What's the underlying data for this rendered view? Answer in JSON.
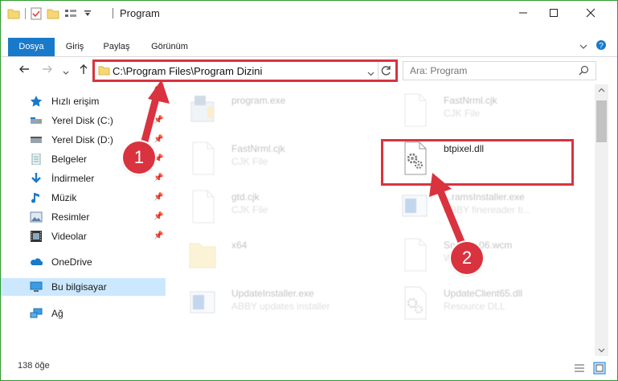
{
  "window": {
    "title": "Program"
  },
  "ribbon": {
    "tabs": [
      {
        "label": "Dosya",
        "active": true
      },
      {
        "label": "Giriş",
        "active": false
      },
      {
        "label": "Paylaş",
        "active": false
      },
      {
        "label": "Görünüm",
        "active": false
      }
    ]
  },
  "address": {
    "path": "C:\\Program Files\\Program Dizini"
  },
  "search": {
    "placeholder": "Ara: Program"
  },
  "sidebar": {
    "items": [
      {
        "label": "Hızlı erişim",
        "icon": "star-icon"
      },
      {
        "label": "Yerel Disk (C:)",
        "icon": "drive-icon",
        "pinned": true
      },
      {
        "label": "Yerel Disk (D:)",
        "icon": "drive-icon",
        "pinned": true
      },
      {
        "label": "Belgeler",
        "icon": "documents-icon",
        "pinned": true
      },
      {
        "label": "İndirmeler",
        "icon": "download-icon",
        "pinned": true
      },
      {
        "label": "Müzik",
        "icon": "music-icon",
        "pinned": true
      },
      {
        "label": "Resimler",
        "icon": "pictures-icon",
        "pinned": true
      },
      {
        "label": "Videolar",
        "icon": "video-icon",
        "pinned": true
      },
      {
        "label": "OneDrive",
        "icon": "onedrive-icon"
      },
      {
        "label": "Bu bilgisayar",
        "icon": "computer-icon",
        "selected": true
      },
      {
        "label": "Ağ",
        "icon": "network-icon"
      }
    ]
  },
  "files": [
    {
      "name": "program.exe",
      "type": "",
      "icon": "exe-icon"
    },
    {
      "name": "FastNrml.cjk",
      "type": "CJK File",
      "icon": "blank-file-icon"
    },
    {
      "name": "FastNrml.cjk",
      "type": "CJK File",
      "icon": "blank-file-icon"
    },
    {
      "name": "btpixel.dll",
      "type": "",
      "icon": "dll-gears-icon"
    },
    {
      "name": "gtd.cjk",
      "type": "CJK File",
      "icon": "blank-file-icon"
    },
    {
      "name": "...ramsInstaller.exe",
      "type": "ABBY finereader ti...",
      "icon": "installer-icon"
    },
    {
      "name": "x64",
      "type": "",
      "icon": "folder-icon"
    },
    {
      "name": "SndTo...06.wcm",
      "type": "WCM...",
      "icon": "blank-file-icon"
    },
    {
      "name": "UpdateInstaller.exe",
      "type": "ABBY updates installer",
      "icon": "installer-icon"
    },
    {
      "name": "UpdateClient65.dll",
      "type": "Resource DLL",
      "icon": "dll-gears-icon"
    }
  ],
  "status": {
    "item_count": "138 öğe"
  },
  "annotations": {
    "badge1": "1",
    "badge2": "2"
  },
  "colors": {
    "accent": "#1979ca",
    "annotation": "#d9333f",
    "selection": "#cce8ff"
  }
}
